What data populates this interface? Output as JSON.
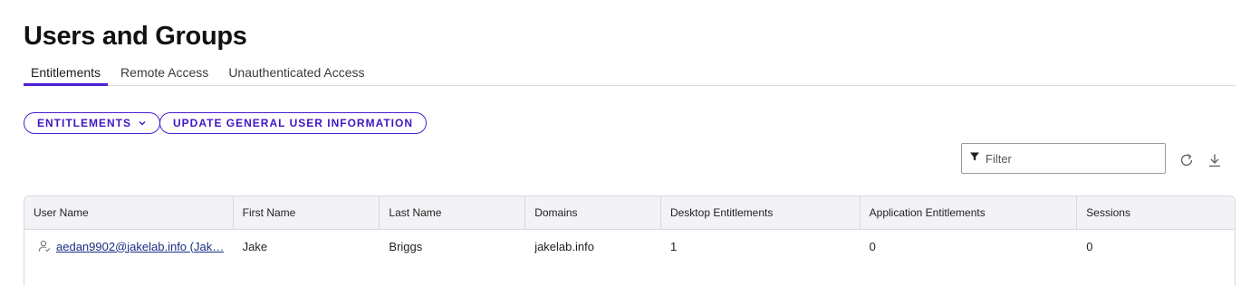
{
  "page": {
    "title": "Users and Groups"
  },
  "tabs": [
    {
      "label": "Entitlements",
      "active": true
    },
    {
      "label": "Remote Access",
      "active": false
    },
    {
      "label": "Unauthenticated Access",
      "active": false
    }
  ],
  "actions": {
    "entitlements_label": "ENTITLEMENTS",
    "update_label": "UPDATE GENERAL USER INFORMATION"
  },
  "toolbar": {
    "filter_placeholder": "Filter",
    "icons": [
      "filter-icon",
      "refresh-icon",
      "download-icon"
    ]
  },
  "table": {
    "columns": [
      "User Name",
      "First Name",
      "Last Name",
      "Domains",
      "Desktop Entitlements",
      "Application Entitlements",
      "Sessions"
    ],
    "rows": [
      {
        "user_name": "aedan9902@jakelab.info (Jak…",
        "first_name": "Jake",
        "last_name": "Briggs",
        "domains": "jakelab.info",
        "desktop_entitlements": "1",
        "application_entitlements": "0",
        "sessions": "0"
      }
    ]
  },
  "colors": {
    "accent": "#4b1fd6",
    "link": "#1a2f82",
    "header_bg": "#f3f3f7",
    "border": "#d9d9de"
  }
}
